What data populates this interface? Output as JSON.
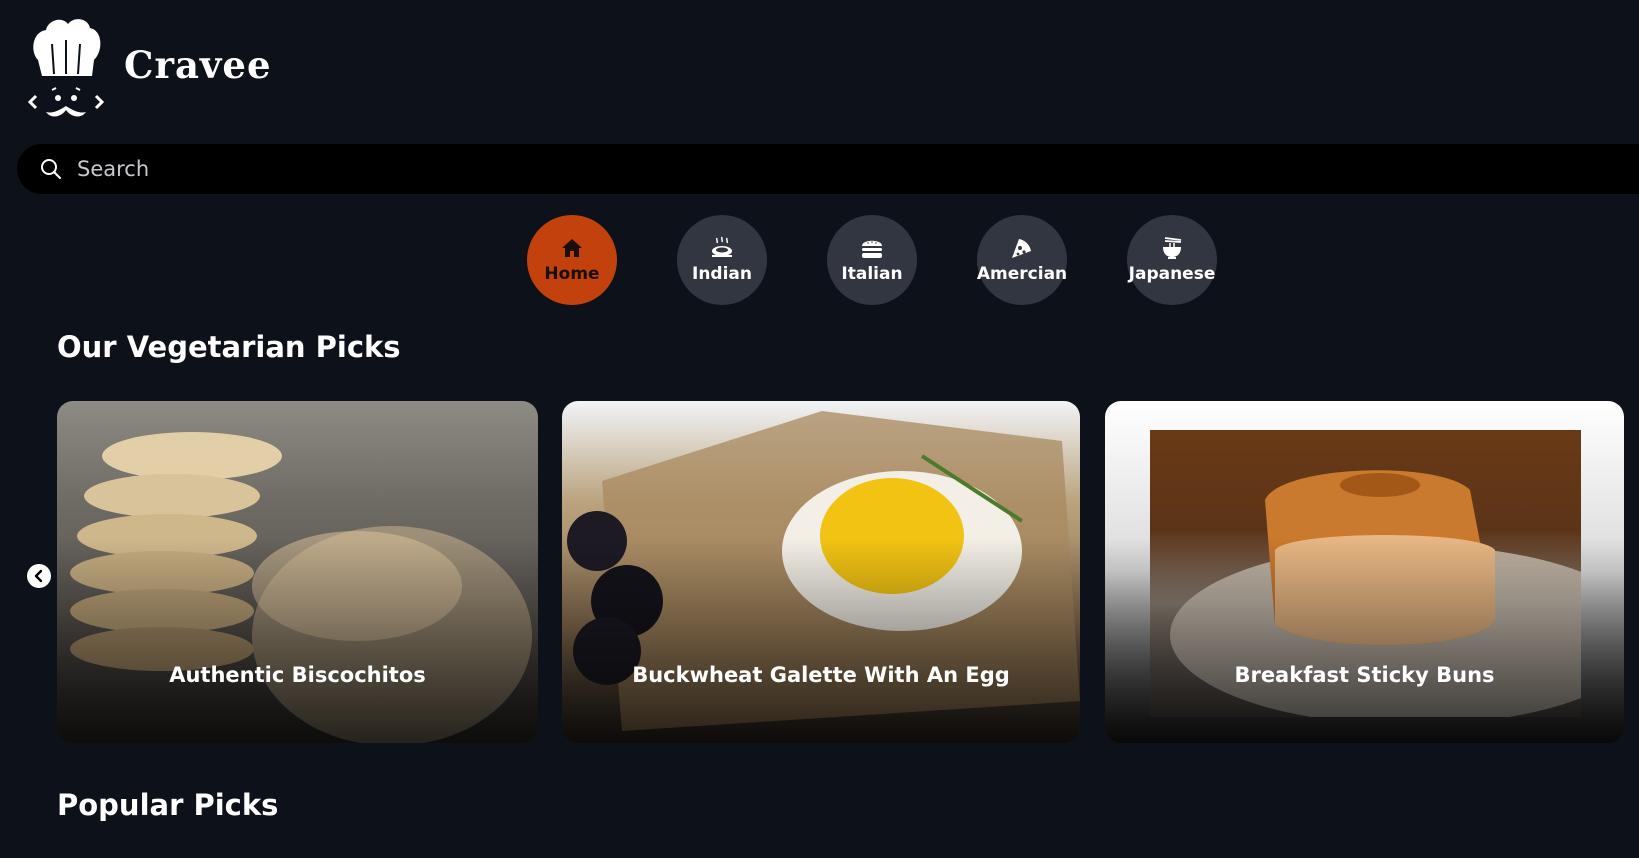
{
  "brand": {
    "name": "Cravee"
  },
  "search": {
    "placeholder": "Search",
    "value": ""
  },
  "categories": [
    {
      "label": "Home",
      "icon": "home-icon",
      "active": true
    },
    {
      "label": "Indian",
      "icon": "indian-dish-icon",
      "active": false
    },
    {
      "label": "Italian",
      "icon": "burger-icon",
      "active": false
    },
    {
      "label": "Amercian",
      "icon": "pizza-slice-icon",
      "active": false
    },
    {
      "label": "Japanese",
      "icon": "noodle-bowl-icon",
      "active": false
    }
  ],
  "sections": {
    "vegetarian": {
      "title": "Our Vegetarian Picks",
      "cards": [
        {
          "title": "Authentic Biscochitos"
        },
        {
          "title": "Buckwheat Galette With An Egg"
        },
        {
          "title": "Breakfast Sticky Buns"
        }
      ]
    },
    "popular": {
      "title": "Popular Picks"
    }
  },
  "colors": {
    "background": "#0d111a",
    "accent": "#c2410c",
    "category_bg": "#313640",
    "search_bg": "#000000"
  }
}
